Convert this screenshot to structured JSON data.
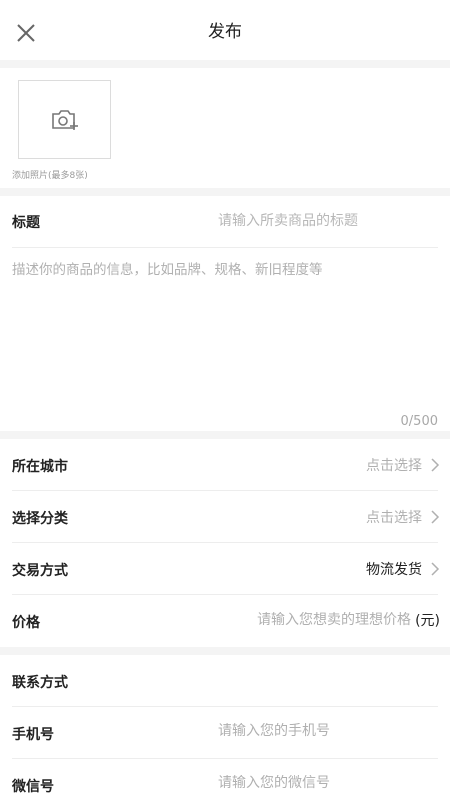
{
  "header": {
    "title": "发布",
    "close_icon": "close-icon"
  },
  "photo": {
    "hint": "添加照片(最多8张)",
    "icon": "camera-add-icon"
  },
  "title_field": {
    "label": "标题",
    "placeholder": "请输入所卖商品的标题"
  },
  "description": {
    "placeholder": "描述你的商品的信息，比如品牌、规格、新旧程度等",
    "counter": "0/500"
  },
  "rows": {
    "city": {
      "label": "所在城市",
      "value": "点击选择"
    },
    "category": {
      "label": "选择分类",
      "value": "点击选择"
    },
    "trade": {
      "label": "交易方式",
      "value": "物流发货"
    },
    "price": {
      "label": "价格",
      "placeholder": "请输入您想卖的理想价格",
      "unit": "(元)"
    }
  },
  "contact": {
    "label": "联系方式",
    "phone": {
      "label": "手机号",
      "placeholder": "请输入您的手机号"
    },
    "wechat": {
      "label": "微信号",
      "placeholder": "请输入您的微信号"
    }
  },
  "colors": {
    "divider": "#ededed",
    "gap": "#f4f4f4",
    "placeholder": "#b0b0b0"
  }
}
